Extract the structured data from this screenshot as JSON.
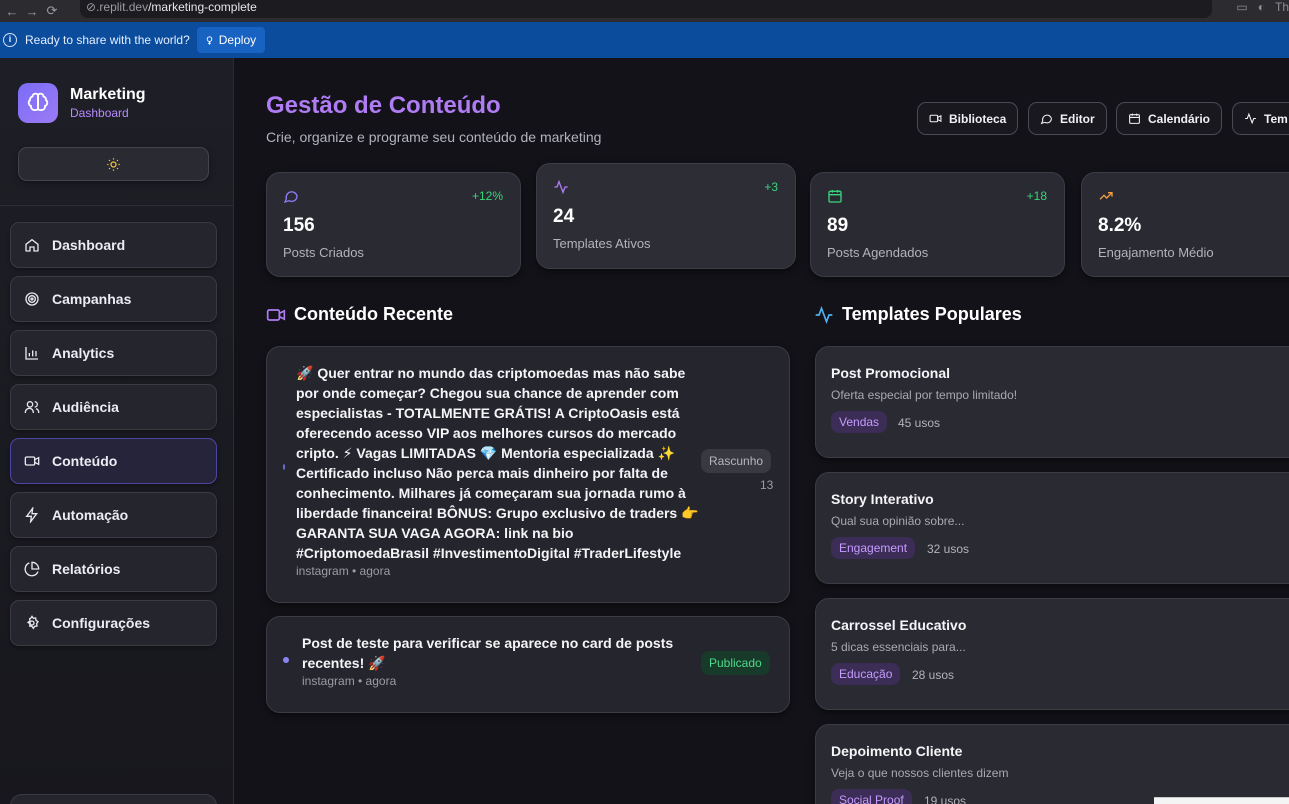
{
  "browser": {
    "url_host": ".replit.dev",
    "url_path": "/marketing-complete",
    "right_text": "Th"
  },
  "deploy_bar": {
    "message": "Ready to share with the world?",
    "button_label": "Deploy"
  },
  "sidebar": {
    "brand_title": "Marketing",
    "brand_subtitle": "Dashboard",
    "items": [
      {
        "label": "Dashboard",
        "icon": "home-icon"
      },
      {
        "label": "Campanhas",
        "icon": "target-icon"
      },
      {
        "label": "Analytics",
        "icon": "bar-chart-icon"
      },
      {
        "label": "Audiência",
        "icon": "users-icon"
      },
      {
        "label": "Conteúdo",
        "icon": "video-icon",
        "active": true
      },
      {
        "label": "Automação",
        "icon": "zap-icon"
      },
      {
        "label": "Relatórios",
        "icon": "pie-chart-icon"
      },
      {
        "label": "Configurações",
        "icon": "settings-icon"
      }
    ]
  },
  "header": {
    "title": "Gestão de Conteúdo",
    "subtitle": "Crie, organize e programe seu conteúdo de marketing",
    "buttons": [
      "Biblioteca",
      "Editor",
      "Calendário",
      "Tem"
    ]
  },
  "stats": [
    {
      "value": "156",
      "label": "Posts Criados",
      "delta": "+12%",
      "icon": "message-icon",
      "icon_color": "#8b7cf6"
    },
    {
      "value": "24",
      "label": "Templates Ativos",
      "delta": "+3",
      "icon": "activity-icon",
      "icon_color": "#b07cf4"
    },
    {
      "value": "89",
      "label": "Posts Agendados",
      "delta": "+18",
      "icon": "calendar-icon",
      "icon_color": "#37d67a"
    },
    {
      "value": "8.2%",
      "label": "Engajamento Médio",
      "delta": "+",
      "icon": "trending-up-icon",
      "icon_color": "#f59e42"
    }
  ],
  "recent": {
    "title": "Conteúdo Recente",
    "posts": [
      {
        "text": "🚀 Quer entrar no mundo das criptomoedas mas não sabe por onde começar? Chegou sua chance de aprender com especialistas - TOTALMENTE GRÁTIS! A CriptoOasis está oferecendo acesso VIP aos melhores cursos do mercado cripto. ⚡ Vagas LIMITADAS 💎 Mentoria especializada ✨ Certificado incluso Não perca mais dinheiro por falta de conhecimento. Milhares já começaram sua jornada rumo à liberdade financeira! BÔNUS: Grupo exclusivo de traders 👉 GARANTA SUA VAGA AGORA: link na bio #CriptomoedaBrasil #InvestimentoDigital #TraderLifestyle",
        "meta": "instagram • agora",
        "status": "Rascunho",
        "count": "13"
      },
      {
        "text": "Post de teste para verificar se aparece no card de posts recentes! 🚀",
        "meta": "instagram • agora",
        "status": "Publicado"
      }
    ]
  },
  "templates": {
    "title": "Templates Populares",
    "items": [
      {
        "name": "Post Promocional",
        "desc": "Oferta especial por tempo limitado!",
        "tag": "Vendas",
        "uses": "45 usos"
      },
      {
        "name": "Story Interativo",
        "desc": "Qual sua opinião sobre...",
        "tag": "Engagement",
        "uses": "32 usos"
      },
      {
        "name": "Carrossel Educativo",
        "desc": "5 dicas essenciais para...",
        "tag": "Educação",
        "uses": "28 usos"
      },
      {
        "name": "Depoimento Cliente",
        "desc": "Veja o que nossos clientes dizem",
        "tag": "Social Proof",
        "uses": "19 usos"
      }
    ]
  },
  "colors": {
    "accent": "#b07cf4",
    "success": "#37d67a",
    "deploy_bar": "#0b4c9c"
  }
}
